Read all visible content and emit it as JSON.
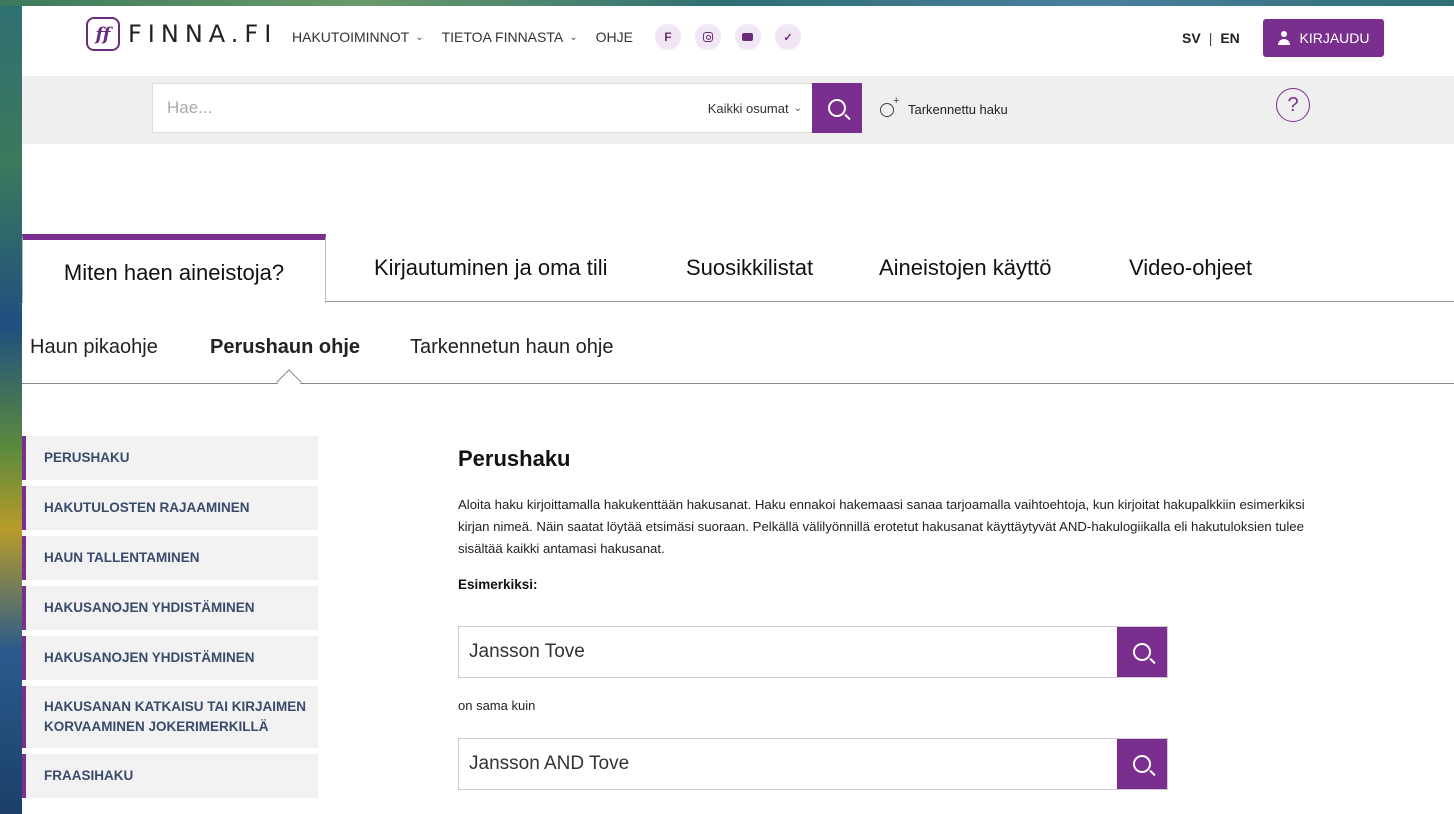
{
  "header": {
    "logo_mark": "ff",
    "logo_text": "FINNA.FI",
    "nav": [
      {
        "label": "HAKUTOIMINNOT",
        "has_dropdown": true
      },
      {
        "label": "TIETOA FINNASTA",
        "has_dropdown": true
      },
      {
        "label": "OHJE",
        "has_dropdown": false
      }
    ],
    "social": [
      "facebook-icon",
      "instagram-icon",
      "youtube-icon",
      "twitter-icon"
    ],
    "facebook_glyph": "f",
    "twitter_glyph": "✓",
    "lang": {
      "sv": "SV",
      "sep": "|",
      "en": "EN"
    },
    "login_label": "KIRJAUDU",
    "accent": "#7a2f8e"
  },
  "search": {
    "placeholder": "Hae...",
    "scope": "Kaikki osumat",
    "advanced": "Tarkennettu haku",
    "help": "?"
  },
  "main_tabs": [
    {
      "label": "Miten haen aineistoja?",
      "active": true
    },
    {
      "label": "Kirjautuminen ja oma tili",
      "active": false
    },
    {
      "label": "Suosikkilistat",
      "active": false
    },
    {
      "label": "Aineistojen käyttö",
      "active": false
    },
    {
      "label": "Video-ohjeet",
      "active": false
    }
  ],
  "sub_tabs": [
    {
      "label": "Haun pikaohje",
      "active": false
    },
    {
      "label": "Perushaun ohje",
      "active": true
    },
    {
      "label": "Tarkennetun haun ohje",
      "active": false
    }
  ],
  "side_menu": [
    "PERUSHAKU",
    "HAKUTULOSTEN RAJAAMINEN",
    "HAUN TALLENTAMINEN",
    "HAKUSANOJEN YHDISTÄMINEN",
    "HAKUSANOJEN YHDISTÄMINEN",
    "HAKUSANAN KATKAISU TAI KIRJAIMEN KORVAAMINEN JOKERIMERKILLÄ",
    "FRAASIHAKU"
  ],
  "content": {
    "title": "Perushaku",
    "paragraph": "Aloita haku kirjoittamalla hakukenttään hakusanat. Haku ennakoi hakemaasi sanaa tarjoamalla vaihtoehtoja, kun kirjoitat hakupalkkiin esimerkiksi kirjan nimeä. Näin saatat löytää etsimäsi suoraan. Pelkällä välilyönnillä erotetut hakusanat käyttäytyvät AND-hakulogiikalla eli hakutuloksien tulee sisältää kaikki antamasi hakusanat.",
    "example_label": "Esimerkiksi:",
    "example1": "Jansson Tove",
    "same_as": "on sama kuin",
    "example2": "Jansson AND Tove"
  }
}
